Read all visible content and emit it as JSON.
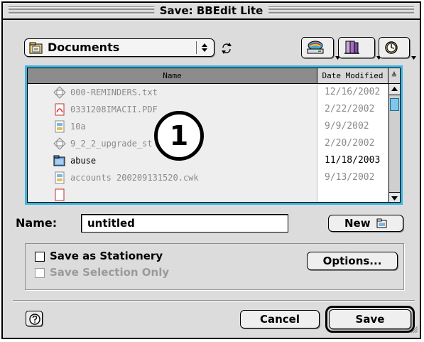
{
  "window": {
    "title": "Save: BBEdit Lite"
  },
  "location": {
    "folder": "Documents",
    "icon": "documents-folder-icon"
  },
  "toolbar": {
    "buttons": [
      {
        "icon": "drive-icon"
      },
      {
        "icon": "shortcuts-icon"
      },
      {
        "icon": "recent-clock-icon"
      }
    ]
  },
  "file_list": {
    "columns": [
      "Name",
      "Date Modified"
    ],
    "sort_indicator": "≜",
    "rows": [
      {
        "name": "000-REMINDERS.txt",
        "date": "12/16/2002",
        "icon": "text-file-icon",
        "enabled": false
      },
      {
        "name": "0331208IMACII.PDF",
        "date": "2/22/2002",
        "icon": "pdf-file-icon",
        "enabled": false
      },
      {
        "name": "10a",
        "date": "9/9/2002",
        "icon": "document-file-icon",
        "enabled": false
      },
      {
        "name": "9_2_2_upgrade_st",
        "date": "2/20/2002",
        "icon": "text-file-icon",
        "enabled": false
      },
      {
        "name": "abuse",
        "date": "11/18/2003",
        "icon": "folder-icon",
        "enabled": true
      },
      {
        "name": "accounts 200209131520.cwk",
        "date": "9/13/2002",
        "icon": "document-file-icon",
        "enabled": false
      }
    ],
    "callout": "1"
  },
  "name_field": {
    "label": "Name:",
    "value": "untitled"
  },
  "buttons": {
    "new": "New",
    "options": "Options...",
    "cancel": "Cancel",
    "save": "Save"
  },
  "options_group": {
    "save_as_stationery": "Save as Stationery",
    "save_selection_only": "Save Selection Only"
  },
  "colors": {
    "list_focus": "#3cb4e0",
    "window_bg": "#dcdcdc"
  }
}
